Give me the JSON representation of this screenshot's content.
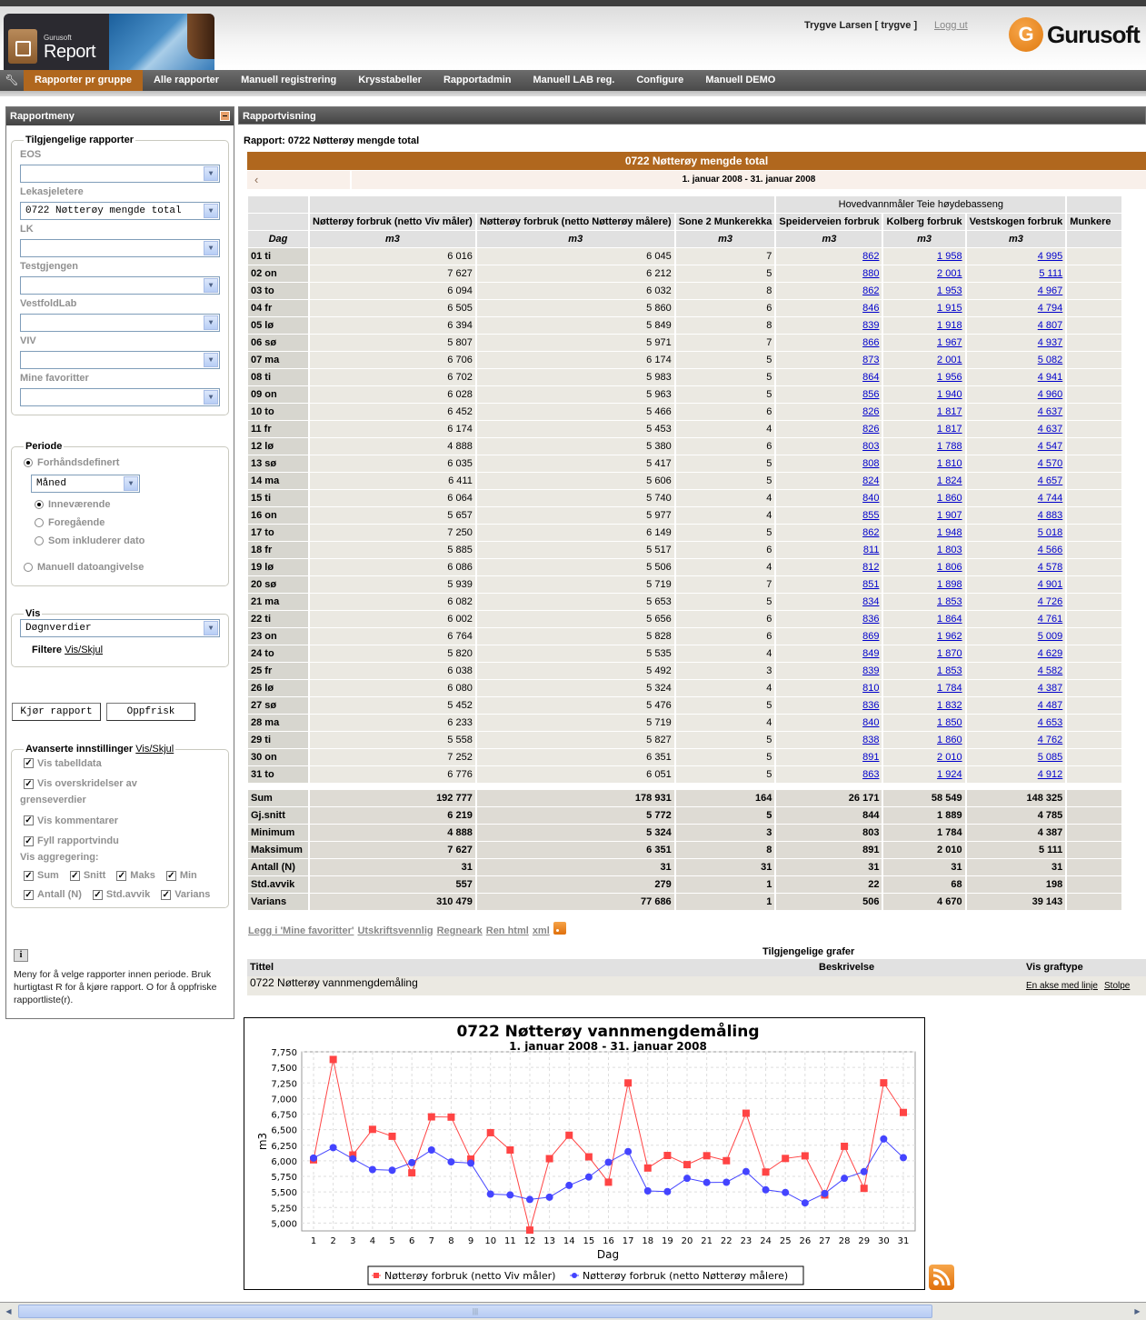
{
  "header": {
    "logo_small": "Gurusoft",
    "logo_big": "Report",
    "user": "Trygve Larsen [ trygve ]",
    "logout": "Logg ut",
    "brand_letter": "G",
    "brand": "Gurusoft",
    "accent_color": "#b0671e"
  },
  "nav": {
    "items": [
      "Rapporter pr gruppe",
      "Alle rapporter",
      "Manuell registrering",
      "Krysstabeller",
      "Rapportadmin",
      "Manuell LAB reg.",
      "Configure",
      "Manuell DEMO"
    ],
    "active_index": 0
  },
  "sidebar": {
    "title": "Rapportmeny",
    "reports_legend": "Tilgjengelige rapporter",
    "groups": [
      {
        "label": "EOS",
        "value": ""
      },
      {
        "label": "Lekasjeletere",
        "value": "0722 Nøtterøy mengde total"
      },
      {
        "label": "LK",
        "value": ""
      },
      {
        "label": "Testgjengen",
        "value": ""
      },
      {
        "label": "VestfoldLab",
        "value": ""
      },
      {
        "label": "VIV",
        "value": ""
      },
      {
        "label": "Mine favoritter",
        "value": ""
      }
    ],
    "period_legend": "Periode",
    "period_predefined": "Forhåndsdefinert",
    "period_select": "Måned",
    "period_current": "Inneværende",
    "period_previous": "Foregående",
    "period_including": "Som inkluderer dato",
    "period_manual": "Manuell datoangivelse",
    "vis_legend": "Vis",
    "vis_select": "Døgnverdier",
    "filter_label": "Filtere",
    "filter_link": "Vis/Skjul",
    "run_button": "Kjør rapport",
    "refresh_button": "Oppfrisk",
    "advanced_legend": "Avanserte innstillinger",
    "advanced_link": "Vis/Skjul",
    "opt_table": "Vis tabelldata",
    "opt_exceed": "Vis overskridelser av",
    "opt_exceed2": "grenseverdier",
    "opt_comments": "Vis kommentarer",
    "opt_fill": "Fyll rapportvindu",
    "agg_label": "Vis aggregering:",
    "agg": [
      "Sum",
      "Snitt",
      "Maks",
      "Min",
      "Antall (N)",
      "Std.avvik",
      "Varians"
    ],
    "info": "Meny for å velge rapporter innen periode. Bruk hurtigtast R for å kjøre rapport. O for å oppfriske rapportliste(r)."
  },
  "main": {
    "panel_title": "Rapportvisning",
    "report_label": "Rapport: 0722 Nøtterøy mengde total",
    "banner": "0722 Nøtterøy mengde total",
    "date_range": "1. januar 2008 - 31. januar 2008",
    "group_header": "Hovedvannmåler Teie høydebasseng",
    "columns": [
      "Nøtterøy forbruk (netto Viv måler)",
      "Nøtterøy forbruk (netto Nøtterøy målere)",
      "Sone 2 Munkerekka",
      "Speiderveien forbruk",
      "Kolberg forbruk",
      "Vestskogen forbruk",
      "Munkere"
    ],
    "day_header": "Dag",
    "unit": "m3",
    "rows": [
      [
        "01 ti",
        "6 016",
        "6 045",
        "7",
        "862",
        "1 958",
        "4 995"
      ],
      [
        "02 on",
        "7 627",
        "6 212",
        "5",
        "880",
        "2 001",
        "5 111"
      ],
      [
        "03 to",
        "6 094",
        "6 032",
        "8",
        "862",
        "1 953",
        "4 967"
      ],
      [
        "04 fr",
        "6 505",
        "5 860",
        "6",
        "846",
        "1 915",
        "4 794"
      ],
      [
        "05 lø",
        "6 394",
        "5 849",
        "8",
        "839",
        "1 918",
        "4 807"
      ],
      [
        "06 sø",
        "5 807",
        "5 971",
        "7",
        "866",
        "1 967",
        "4 937"
      ],
      [
        "07 ma",
        "6 706",
        "6 174",
        "5",
        "873",
        "2 001",
        "5 082"
      ],
      [
        "08 ti",
        "6 702",
        "5 983",
        "5",
        "864",
        "1 956",
        "4 941"
      ],
      [
        "09 on",
        "6 028",
        "5 963",
        "5",
        "856",
        "1 940",
        "4 960"
      ],
      [
        "10 to",
        "6 452",
        "5 466",
        "6",
        "826",
        "1 817",
        "4 637"
      ],
      [
        "11 fr",
        "6 174",
        "5 453",
        "4",
        "826",
        "1 817",
        "4 637"
      ],
      [
        "12 lø",
        "4 888",
        "5 380",
        "6",
        "803",
        "1 788",
        "4 547"
      ],
      [
        "13 sø",
        "6 035",
        "5 417",
        "5",
        "808",
        "1 810",
        "4 570"
      ],
      [
        "14 ma",
        "6 411",
        "5 606",
        "5",
        "824",
        "1 824",
        "4 657"
      ],
      [
        "15 ti",
        "6 064",
        "5 740",
        "4",
        "840",
        "1 860",
        "4 744"
      ],
      [
        "16 on",
        "5 657",
        "5 977",
        "4",
        "855",
        "1 907",
        "4 883"
      ],
      [
        "17 to",
        "7 250",
        "6 149",
        "5",
        "862",
        "1 948",
        "5 018"
      ],
      [
        "18 fr",
        "5 885",
        "5 517",
        "6",
        "811",
        "1 803",
        "4 566"
      ],
      [
        "19 lø",
        "6 086",
        "5 506",
        "4",
        "812",
        "1 806",
        "4 578"
      ],
      [
        "20 sø",
        "5 939",
        "5 719",
        "7",
        "851",
        "1 898",
        "4 901"
      ],
      [
        "21 ma",
        "6 082",
        "5 653",
        "5",
        "834",
        "1 853",
        "4 726"
      ],
      [
        "22 ti",
        "6 002",
        "5 656",
        "6",
        "836",
        "1 864",
        "4 761"
      ],
      [
        "23 on",
        "6 764",
        "5 828",
        "6",
        "869",
        "1 962",
        "5 009"
      ],
      [
        "24 to",
        "5 820",
        "5 535",
        "4",
        "849",
        "1 870",
        "4 629"
      ],
      [
        "25 fr",
        "6 038",
        "5 492",
        "3",
        "839",
        "1 853",
        "4 582"
      ],
      [
        "26 lø",
        "6 080",
        "5 324",
        "4",
        "810",
        "1 784",
        "4 387"
      ],
      [
        "27 sø",
        "5 452",
        "5 476",
        "5",
        "836",
        "1 832",
        "4 487"
      ],
      [
        "28 ma",
        "6 233",
        "5 719",
        "4",
        "840",
        "1 850",
        "4 653"
      ],
      [
        "29 ti",
        "5 558",
        "5 827",
        "5",
        "838",
        "1 860",
        "4 762"
      ],
      [
        "30 on",
        "7 252",
        "6 351",
        "5",
        "891",
        "2 010",
        "5 085"
      ],
      [
        "31 to",
        "6 776",
        "6 051",
        "5",
        "863",
        "1 924",
        "4 912"
      ]
    ],
    "aggregates": [
      [
        "Sum",
        "192 777",
        "178 931",
        "164",
        "26 171",
        "58 549",
        "148 325"
      ],
      [
        "Gj.snitt",
        "6 219",
        "5 772",
        "5",
        "844",
        "1 889",
        "4 785"
      ],
      [
        "Minimum",
        "4 888",
        "5 324",
        "3",
        "803",
        "1 784",
        "4 387"
      ],
      [
        "Maksimum",
        "7 627",
        "6 351",
        "8",
        "891",
        "2 010",
        "5 111"
      ],
      [
        "Antall (N)",
        "31",
        "31",
        "31",
        "31",
        "31",
        "31"
      ],
      [
        "Std.avvik",
        "557",
        "279",
        "1",
        "22",
        "68",
        "198"
      ],
      [
        "Varians",
        "310 479",
        "77 686",
        "1",
        "506",
        "4 670",
        "39 143"
      ]
    ],
    "links": [
      "Legg i 'Mine favoritter'",
      "Utskriftsvennlig",
      "Regneark",
      "Ren html",
      "xml"
    ],
    "graphs_title": "Tilgjengelige grafer",
    "graphs_headers": {
      "title": "Tittel",
      "desc": "Beskrivelse",
      "type": "Vis graftype"
    },
    "graph_row": {
      "title": "0722 Nøtterøy vannmengdemåling",
      "desc": "",
      "type1": "En akse med linje",
      "type2": "Stolpe"
    }
  },
  "chart_data": {
    "type": "line",
    "title": "0722 Nøtterøy vannmengdemåling",
    "subtitle": "1. januar 2008 - 31. januar 2008",
    "xlabel": "Dag",
    "ylabel": "m3",
    "ylim": [
      4875,
      7750
    ],
    "yticks": [
      "5,000",
      "5,250",
      "5,500",
      "5,750",
      "6,000",
      "6,250",
      "6,500",
      "6,750",
      "7,000",
      "7,250",
      "7,500",
      "7,750"
    ],
    "ytick_values": [
      5000,
      5250,
      5500,
      5750,
      6000,
      6250,
      6500,
      6750,
      7000,
      7250,
      7500,
      7750
    ],
    "x": [
      1,
      2,
      3,
      4,
      5,
      6,
      7,
      8,
      9,
      10,
      11,
      12,
      13,
      14,
      15,
      16,
      17,
      18,
      19,
      20,
      21,
      22,
      23,
      24,
      25,
      26,
      27,
      28,
      29,
      30,
      31
    ],
    "grid": true,
    "legend_position": "bottom",
    "series": [
      {
        "name": "Nøtterøy forbruk (netto Viv måler)",
        "color": "#ff4444",
        "marker": "square",
        "values": [
          6016,
          7627,
          6094,
          6505,
          6394,
          5807,
          6706,
          6702,
          6028,
          6452,
          6174,
          4888,
          6035,
          6411,
          6064,
          5657,
          7250,
          5885,
          6086,
          5939,
          6082,
          6002,
          6764,
          5820,
          6038,
          6080,
          5452,
          6233,
          5558,
          7252,
          6776
        ]
      },
      {
        "name": "Nøtterøy forbruk (netto Nøtterøy målere)",
        "color": "#4444ff",
        "marker": "circle",
        "values": [
          6045,
          6212,
          6032,
          5860,
          5849,
          5971,
          6174,
          5983,
          5963,
          5466,
          5453,
          5380,
          5417,
          5606,
          5740,
          5977,
          6149,
          5517,
          5506,
          5719,
          5653,
          5656,
          5828,
          5535,
          5492,
          5324,
          5476,
          5719,
          5827,
          6351,
          6051
        ]
      }
    ]
  }
}
